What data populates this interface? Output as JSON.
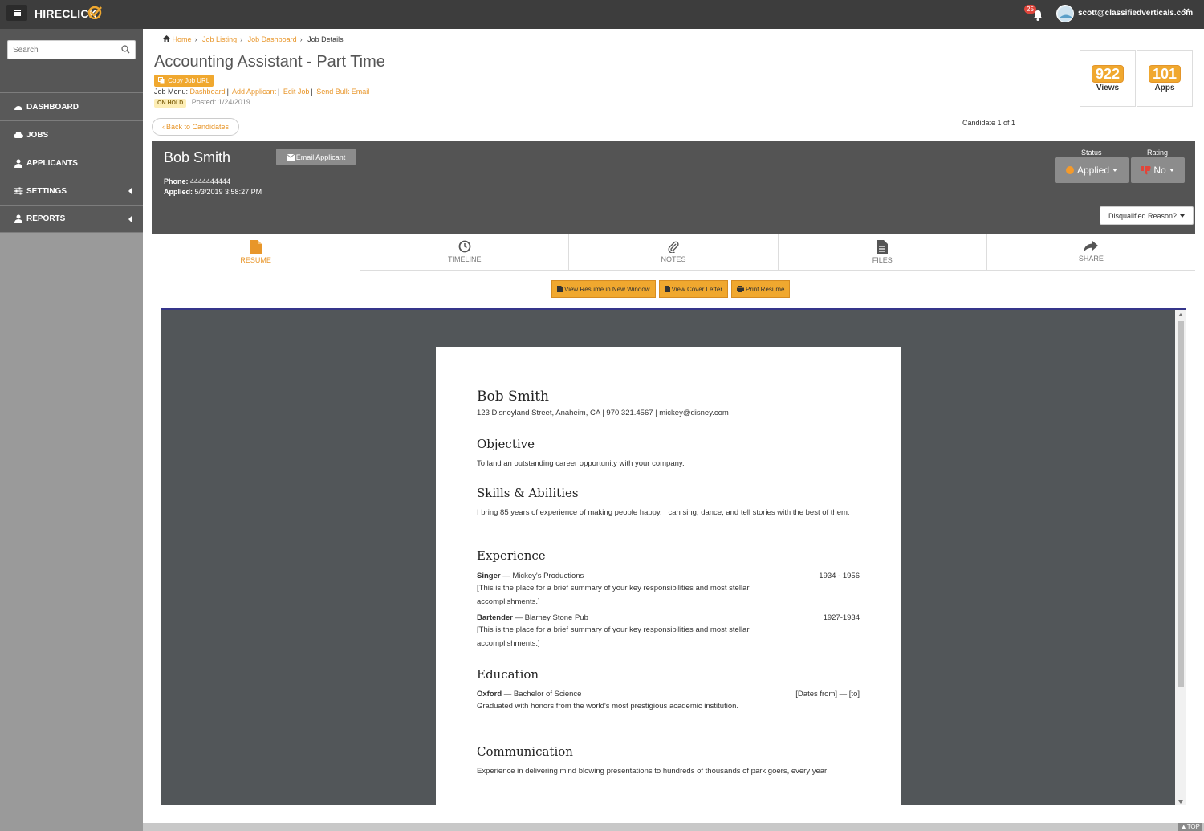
{
  "app": {
    "brand": "HIRECLICK",
    "notification_count": "25",
    "user_email": "scott@classifiedverticals.com"
  },
  "sidebar": {
    "search_placeholder": "Search",
    "items": [
      {
        "label": "DASHBOARD"
      },
      {
        "label": "JOBS"
      },
      {
        "label": "APPLICANTS"
      },
      {
        "label": "SETTINGS"
      },
      {
        "label": "REPORTS"
      }
    ]
  },
  "breadcrumb": {
    "home": "Home",
    "job_listing": "Job Listing",
    "job_dashboard": "Job Dashboard",
    "current": "Job Details"
  },
  "job": {
    "title": "Accounting Assistant - Part Time",
    "copy_url": "Copy Job URL",
    "menu_label": "Job Menu:",
    "menu_dashboard": "Dashboard",
    "menu_add_applicant": "Add Applicant",
    "menu_edit_job": "Edit Job",
    "menu_bulk_email": "Send Bulk Email",
    "hold_badge": "ON HOLD",
    "posted": "Posted: 1/24/2019"
  },
  "stats": {
    "views": "922",
    "views_label": "Views",
    "apps": "101",
    "apps_label": "Apps"
  },
  "nav": {
    "back": "Back to Candidates",
    "candidate_count": "Candidate 1 of 1"
  },
  "candidate": {
    "name": "Bob Smith",
    "email_button": "Email Applicant",
    "phone_label": "Phone:",
    "phone": "4444444444",
    "applied_label": "Applied:",
    "applied": "5/3/2019 3:58:27 PM",
    "status_label": "Status",
    "status": "Applied",
    "status_color": "#f49a2b",
    "rating_label": "Rating",
    "rating": "No",
    "disqualified": "Disqualified Reason?"
  },
  "tabs": [
    {
      "label": "RESUME",
      "icon": "file-icon"
    },
    {
      "label": "TIMELINE",
      "icon": "clock-icon"
    },
    {
      "label": "NOTES",
      "icon": "paperclip-icon"
    },
    {
      "label": "FILES",
      "icon": "files-icon"
    },
    {
      "label": "SHARE",
      "icon": "share-icon"
    }
  ],
  "resume_actions": {
    "new_window": "View Resume in New Window",
    "cover_letter": "View Cover Letter",
    "print": "Print Resume"
  },
  "resume": {
    "name": "Bob Smith",
    "contact": "123 Disneyland Street, Anaheim, CA  |  970.321.4567  |  mickey@disney.com",
    "objective_h": "Objective",
    "objective": "To land an outstanding career opportunity with your company.",
    "skills_h": "Skills & Abilities",
    "skills": "I bring 85 years of experience of making people happy. I can sing, dance, and tell stories with the best of them.",
    "experience_h": "Experience",
    "jobs": [
      {
        "role": "Singer",
        "company": " — Mickey's Productions",
        "dates": "1934 - 1956",
        "summary": "[This is the place for a brief summary of your key responsibilities and most stellar accomplishments.]"
      },
      {
        "role": "Bartender",
        "company": " — Blarney Stone Pub",
        "dates": "1927-1934",
        "summary": "[This is the place for a brief summary of your key responsibilities and most stellar accomplishments.]"
      }
    ],
    "education_h": "Education",
    "school": "Oxford",
    "degree": " — Bachelor of Science",
    "edu_dates": "[Dates from] — [to]",
    "edu_desc": "Graduated with honors from the world's most prestigious academic institution.",
    "comm_h": "Communication",
    "comm": "Experience in delivering mind blowing presentations to hundreds of thousands of park goers, every year!"
  },
  "footer": {
    "top": "TOP"
  }
}
